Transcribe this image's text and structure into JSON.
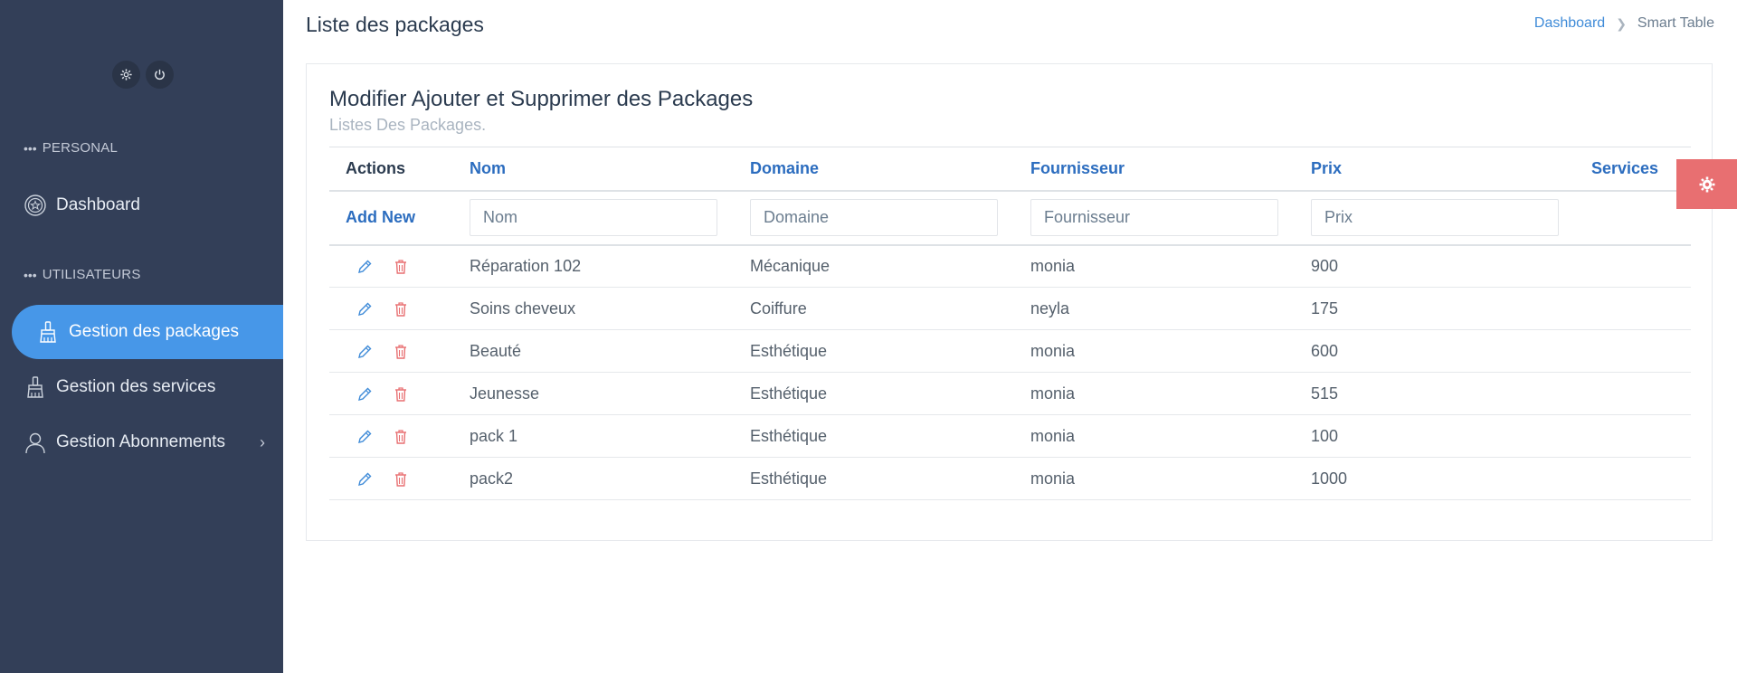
{
  "sidebar": {
    "sections": {
      "personal": "PERSONAL",
      "utilisateurs": "UTILISATEURS"
    },
    "items": [
      {
        "label": "Dashboard",
        "icon": "dashboard-icon"
      },
      {
        "label": "Gestion des packages",
        "icon": "brush-icon",
        "active": true
      },
      {
        "label": "Gestion des services",
        "icon": "brush-icon"
      },
      {
        "label": "Gestion Abonnements",
        "icon": "user-icon"
      }
    ]
  },
  "header": {
    "title": "Liste des packages",
    "breadcrumb": [
      "Dashboard",
      "Smart Table"
    ]
  },
  "card": {
    "title": "Modifier Ajouter et Supprimer des Packages",
    "subtitle": "Listes Des Packages."
  },
  "table": {
    "headers": {
      "actions": "Actions",
      "nom": "Nom",
      "domaine": "Domaine",
      "fournisseur": "Fournisseur",
      "prix": "Prix",
      "services": "Services"
    },
    "add_new": "Add New",
    "filters": {
      "nom": "Nom",
      "domaine": "Domaine",
      "fournisseur": "Fournisseur",
      "prix": "Prix"
    },
    "rows": [
      {
        "nom": "Réparation 102",
        "domaine": "Mécanique",
        "fournisseur": "monia",
        "prix": "900"
      },
      {
        "nom": "Soins cheveux",
        "domaine": "Coiffure",
        "fournisseur": "neyla",
        "prix": "175"
      },
      {
        "nom": "Beauté",
        "domaine": "Esthétique",
        "fournisseur": "monia",
        "prix": "600"
      },
      {
        "nom": "Jeunesse",
        "domaine": "Esthétique",
        "fournisseur": "monia",
        "prix": "515"
      },
      {
        "nom": "pack 1",
        "domaine": "Esthétique",
        "fournisseur": "monia",
        "prix": "100"
      },
      {
        "nom": "pack2",
        "domaine": "Esthétique",
        "fournisseur": "monia",
        "prix": "1000"
      }
    ]
  },
  "colors": {
    "sidebar_bg": "#333f58",
    "active_item": "#4797e8",
    "link_blue": "#2c6dbf",
    "delete_red": "#e86f71"
  }
}
